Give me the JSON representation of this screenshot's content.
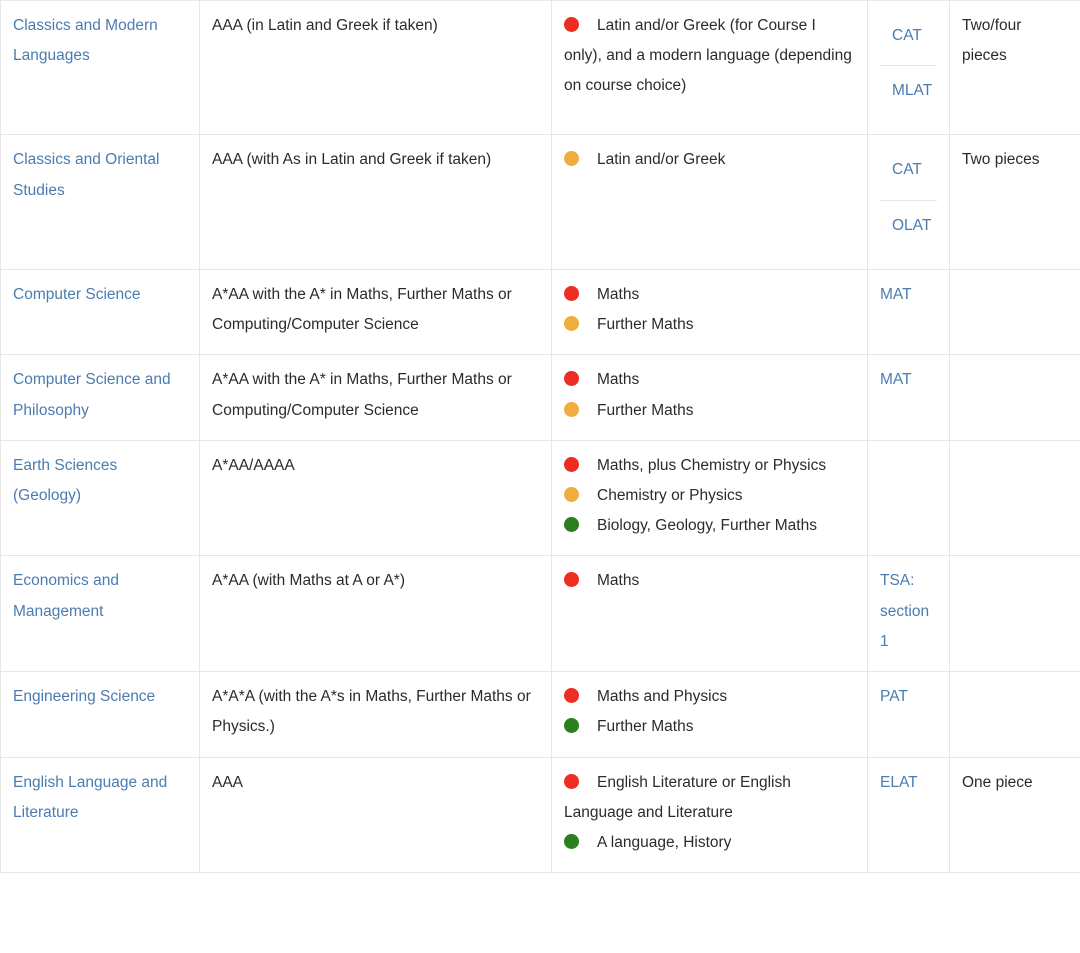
{
  "table": {
    "colors": {
      "link": "#4a7cb0",
      "dot_red": "#ee2d22",
      "dot_amber": "#f0ad3e",
      "dot_green": "#2e7d1e",
      "border": "#e6e6e6",
      "text": "#2b2b2b"
    },
    "rows": [
      {
        "course": "Classics and Modern Languages",
        "offer": "AAA (in Latin and Greek if taken)",
        "subjects": [
          {
            "dot": "red",
            "text": "Latin and/or Greek (for Course I only), and a modern language (depending on course choice)"
          }
        ],
        "tests": [
          "CAT",
          "MLAT"
        ],
        "written_work": "Two/four pieces"
      },
      {
        "course": "Classics and Oriental Studies",
        "offer": "AAA (with As in Latin and Greek if taken)",
        "subjects": [
          {
            "dot": "amber",
            "text": "Latin and/or Greek"
          }
        ],
        "tests": [
          "CAT",
          "OLAT"
        ],
        "written_work": "Two pieces"
      },
      {
        "course": "Computer Science",
        "offer": "A*AA with the A* in Maths, Further Maths or Computing/Computer Science",
        "subjects": [
          {
            "dot": "red",
            "text": "Maths"
          },
          {
            "dot": "amber",
            "text": "Further Maths"
          }
        ],
        "tests": [
          "MAT"
        ],
        "written_work": ""
      },
      {
        "course": "Computer Science and Philosophy",
        "offer": "A*AA with the A* in Maths, Further Maths or Computing/Computer Science",
        "subjects": [
          {
            "dot": "red",
            "text": "Maths"
          },
          {
            "dot": "amber",
            "text": "Further Maths"
          }
        ],
        "tests": [
          "MAT"
        ],
        "written_work": ""
      },
      {
        "course": "Earth Sciences (Geology)",
        "offer": "A*AA/AAAA",
        "subjects": [
          {
            "dot": "red",
            "text": "Maths, plus Chemistry or Physics"
          },
          {
            "dot": "amber",
            "text": "Chemistry or Physics"
          },
          {
            "dot": "green",
            "text": "Biology, Geology, Further Maths"
          }
        ],
        "tests": [],
        "written_work": ""
      },
      {
        "course": "Economics and Management",
        "offer": "A*AA (with Maths at A or A*)",
        "subjects": [
          {
            "dot": "red",
            "text": "Maths"
          }
        ],
        "tests": [
          "TSA: section 1"
        ],
        "written_work": ""
      },
      {
        "course": "Engineering Science",
        "offer": "A*A*A (with the A*s in Maths, Further Maths or Physics.)",
        "subjects": [
          {
            "dot": "red",
            "text": "Maths and Physics"
          },
          {
            "dot": "green",
            "text": "Further Maths"
          }
        ],
        "tests": [
          "PAT"
        ],
        "written_work": ""
      },
      {
        "course": "English Language and Literature",
        "offer": "AAA",
        "subjects": [
          {
            "dot": "red",
            "text": "English Literature or English Language and Literature"
          },
          {
            "dot": "green",
            "text": "A language, History"
          }
        ],
        "tests": [
          "ELAT"
        ],
        "written_work": "One piece"
      }
    ]
  }
}
